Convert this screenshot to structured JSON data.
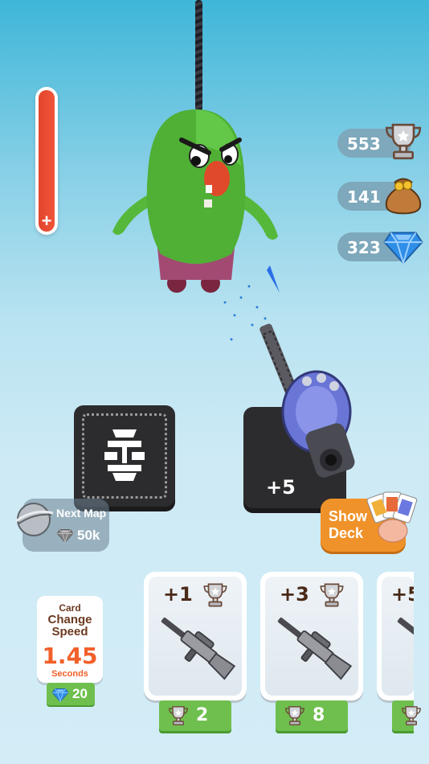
{
  "hud": {
    "health": 1.0,
    "health_symbol": "+",
    "trophies": "553",
    "coins": "141",
    "gems": "323"
  },
  "table_cards": [
    {
      "type": "face-down"
    },
    {
      "label": "+5"
    }
  ],
  "next_map": {
    "title": "Next Map",
    "cost": "50k"
  },
  "show_deck": {
    "label_line1": "Show",
    "label_line2": "Deck"
  },
  "card_change_speed": {
    "line1": "Card",
    "line2": "Change",
    "line3": "Speed",
    "value": "1.45",
    "unit": "Seconds",
    "cost": "20"
  },
  "upgrades": [
    {
      "bonus": "+1",
      "cost": "2"
    },
    {
      "bonus": "+3",
      "cost": "8"
    },
    {
      "bonus": "+5",
      "cost": ""
    }
  ],
  "colors": {
    "health": "#e2452c",
    "buy_button": "#6fbf4e",
    "show_deck": "#f0922a",
    "speed_value": "#f2602a"
  }
}
